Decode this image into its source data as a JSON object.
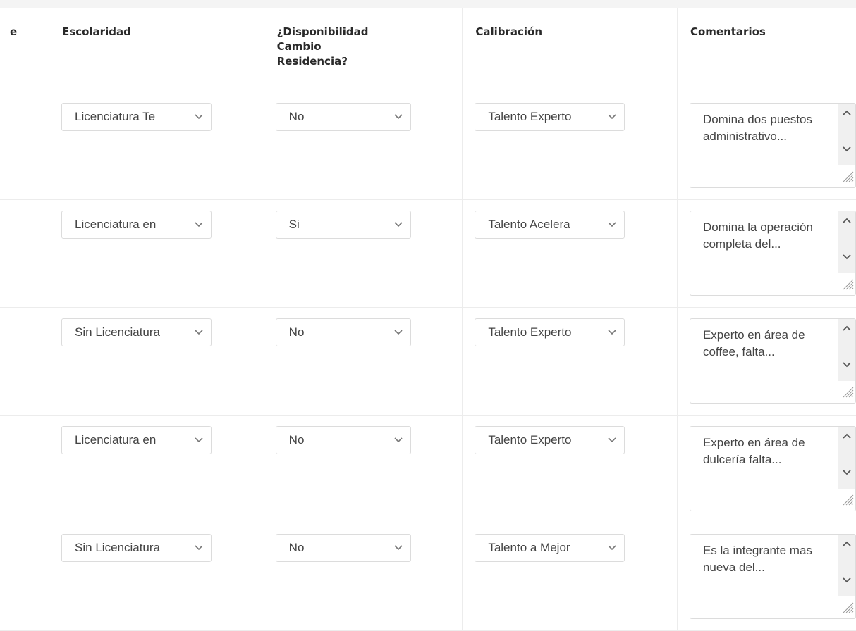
{
  "headers": {
    "partial": "e",
    "escolaridad": "Escolaridad",
    "disponibilidad": [
      "¿Disponibilidad",
      "Cambio",
      "Residencia?"
    ],
    "calibracion": "Calibración",
    "comentarios": "Comentarios"
  },
  "rows": [
    {
      "escolaridad": "Licenciatura Te",
      "disponibilidad": "No",
      "calibracion": "Talento Experto",
      "comentarios": "Domina dos puestos administrativo..."
    },
    {
      "escolaridad": "Licenciatura en",
      "disponibilidad": "Si",
      "calibracion": "Talento Acelera",
      "comentarios": "Domina la operación completa del..."
    },
    {
      "escolaridad": "Sin Licenciatura",
      "disponibilidad": "No",
      "calibracion": "Talento Experto",
      "comentarios": "Experto en área de coffee, falta..."
    },
    {
      "escolaridad": "Licenciatura en",
      "disponibilidad": "No",
      "calibracion": "Talento Experto",
      "comentarios": "Experto en área de dulcería falta..."
    },
    {
      "escolaridad": "Sin Licenciatura",
      "disponibilidad": "No",
      "calibracion": "Talento a Mejor",
      "comentarios": "Es la integrante mas nueva del..."
    }
  ],
  "icons": {
    "select_arrow": "chevron-down-icon",
    "scroll_up": "caret-up-icon",
    "scroll_down": "caret-down-icon",
    "resize": "resize-grip-icon"
  },
  "colors": {
    "border": "#dcdcdc",
    "grid": "#ececec",
    "text": "#444444",
    "header_text": "#2a2a2a"
  }
}
